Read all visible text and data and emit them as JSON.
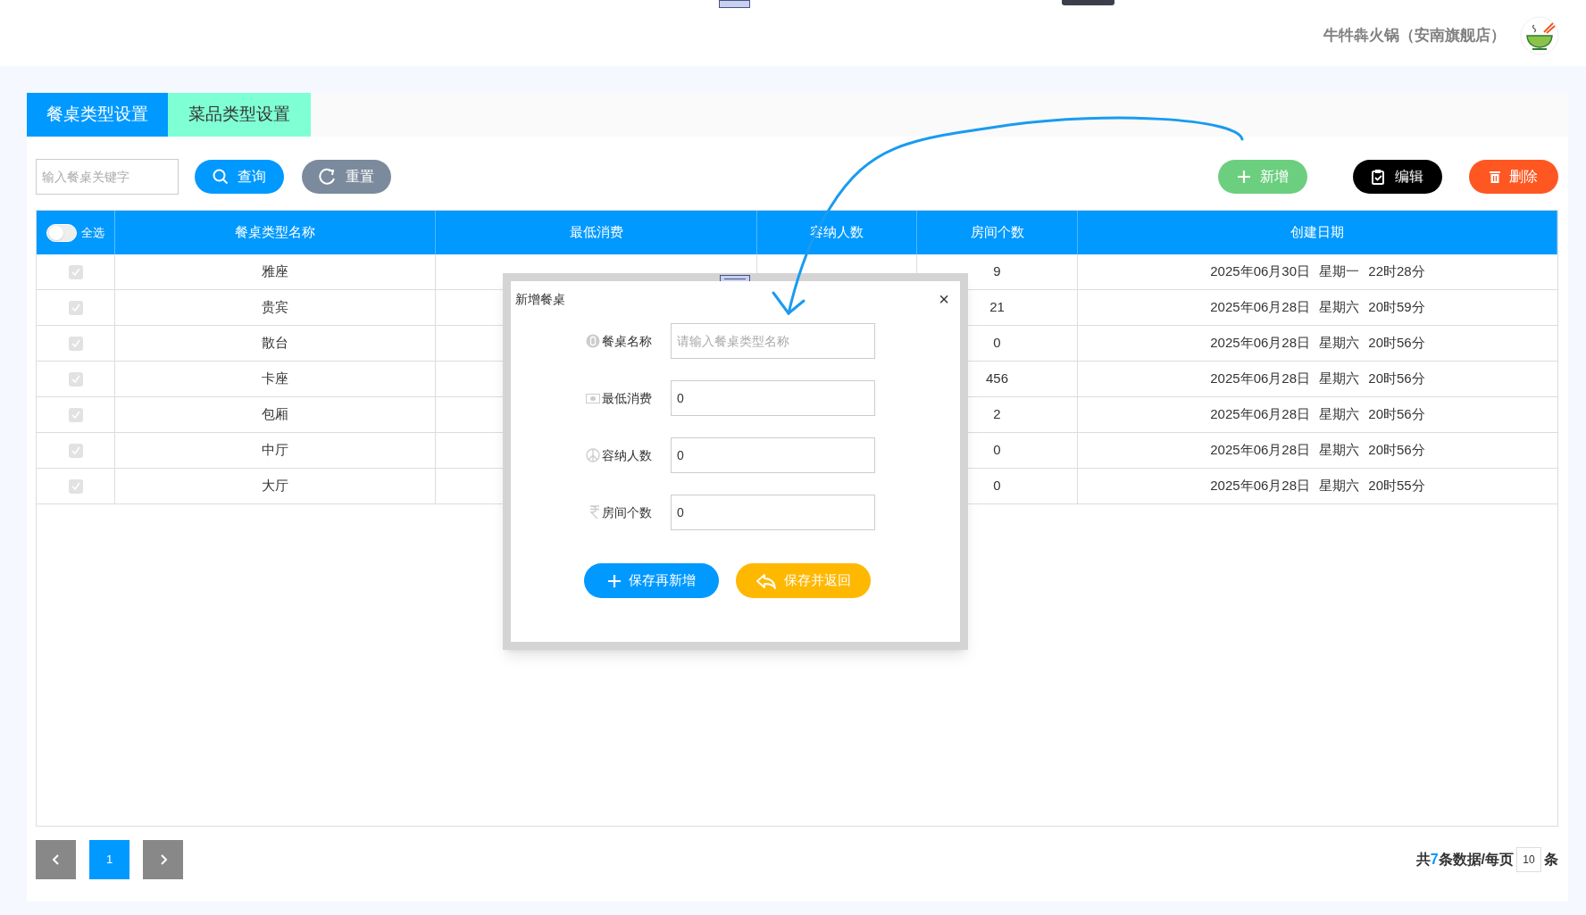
{
  "header": {
    "store_name": "牛牪犇火锅（安南旗舰店）"
  },
  "tabs": [
    {
      "label": "餐桌类型设置",
      "selected": true
    },
    {
      "label": "菜品类型设置",
      "selected": false
    }
  ],
  "toolbar": {
    "search": {
      "placeholder": "输入餐桌关键字"
    },
    "buttons": [
      {
        "label": "查询",
        "kind": "search"
      },
      {
        "label": "重置",
        "kind": "reset"
      },
      {
        "label": "新增",
        "kind": "add"
      },
      {
        "label": "编辑",
        "kind": "edit"
      },
      {
        "label": "删除",
        "kind": "delete"
      }
    ]
  },
  "table": {
    "select_all": {
      "label": "全选",
      "on": false
    },
    "columns": [
      "餐桌类型名称",
      "最低消费",
      "容纳人数",
      "房间个数",
      "创建日期"
    ],
    "rows": [
      {
        "checked": true,
        "name": "雅座",
        "rooms": "9",
        "created": "2025年06月30日 星期一 22时28分"
      },
      {
        "checked": true,
        "name": "贵宾",
        "rooms": "21",
        "created": "2025年06月28日 星期六 20时59分"
      },
      {
        "checked": true,
        "name": "散台",
        "rooms": "0",
        "created": "2025年06月28日 星期六 20时56分"
      },
      {
        "checked": true,
        "name": "卡座",
        "rooms": "456",
        "created": "2025年06月28日 星期六 20时56分"
      },
      {
        "checked": true,
        "name": "包厢",
        "rooms": "2",
        "created": "2025年06月28日 星期六 20时56分"
      },
      {
        "checked": true,
        "name": "中厅",
        "rooms": "0",
        "created": "2025年06月28日 星期六 20时56分"
      },
      {
        "checked": true,
        "name": "大厅",
        "rooms": "0",
        "created": "2025年06月28日 星期六 20时55分"
      }
    ]
  },
  "pagination": {
    "pages": [
      {
        "label": "1",
        "selected": true
      }
    ],
    "total_prefix": "共",
    "total": "7",
    "total_suffix": "条数据/每页",
    "page_size": "10",
    "unit": "条"
  },
  "dialog": {
    "title": "新增餐桌",
    "close": "×",
    "fields": [
      {
        "kind": "badge",
        "label": "餐桌名称",
        "placeholder": "请输入餐桌类型名称"
      },
      {
        "kind": "cash",
        "label": "最低消费",
        "value": "0"
      },
      {
        "kind": "peace",
        "label": "容纳人数",
        "value": "0"
      },
      {
        "kind": "rupee",
        "label": "房间个数",
        "value": "0"
      }
    ],
    "buttons": [
      {
        "label": "保存再新增",
        "kind": "add"
      },
      {
        "label": "保存并返回",
        "kind": "back"
      }
    ]
  }
}
